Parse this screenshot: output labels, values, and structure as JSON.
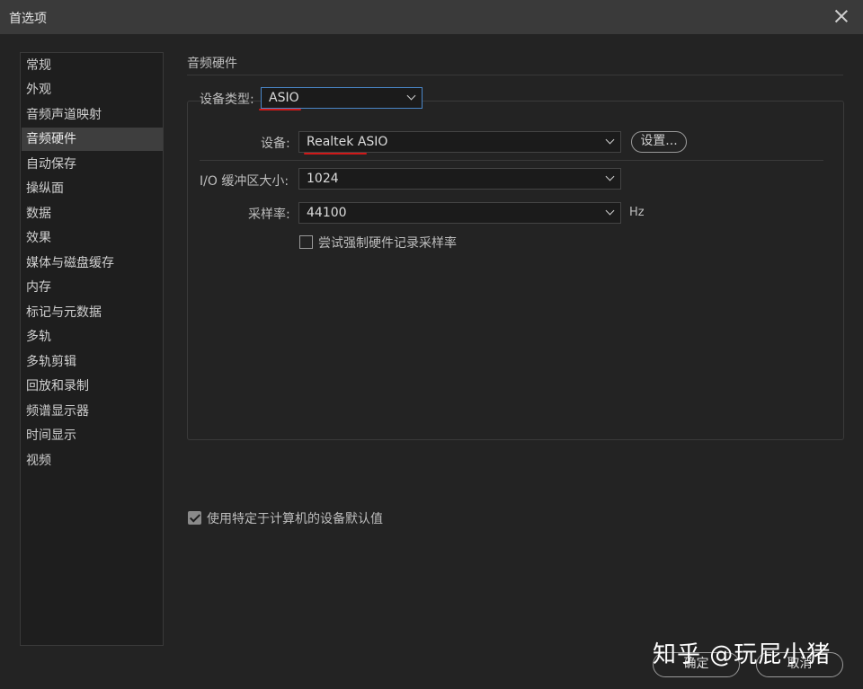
{
  "window": {
    "title": "首选项"
  },
  "sidebar": {
    "items": [
      {
        "label": "常规"
      },
      {
        "label": "外观"
      },
      {
        "label": "音频声道映射"
      },
      {
        "label": "音频硬件",
        "active": true
      },
      {
        "label": "自动保存"
      },
      {
        "label": "操纵面"
      },
      {
        "label": "数据"
      },
      {
        "label": "效果"
      },
      {
        "label": "媒体与磁盘缓存"
      },
      {
        "label": "内存"
      },
      {
        "label": "标记与元数据"
      },
      {
        "label": "多轨"
      },
      {
        "label": "多轨剪辑"
      },
      {
        "label": "回放和录制"
      },
      {
        "label": "频谱显示器"
      },
      {
        "label": "时间显示"
      },
      {
        "label": "视频"
      }
    ]
  },
  "panel": {
    "section_title": "音频硬件",
    "device_type": {
      "label": "设备类型:",
      "value": "ASIO"
    },
    "device": {
      "label": "设备:",
      "value": "Realtek ASIO",
      "settings_button": "设置..."
    },
    "buffer_size": {
      "label": "I/O 缓冲区大小:",
      "value": "1024"
    },
    "sample_rate": {
      "label": "采样率:",
      "value": "44100",
      "unit": "Hz"
    },
    "force_sample_rate": {
      "label": "尝试强制硬件记录采样率",
      "checked": false
    },
    "use_machine_defaults": {
      "label": "使用特定于计算机的设备默认值",
      "checked": true
    }
  },
  "footer": {
    "ok_button": "确定",
    "cancel_button": "取消"
  },
  "watermark": "知乎 @玩屁小猪",
  "colors": {
    "background": "#232323",
    "annotation_red": "#d01818",
    "focus_blue": "#4a86c8"
  }
}
